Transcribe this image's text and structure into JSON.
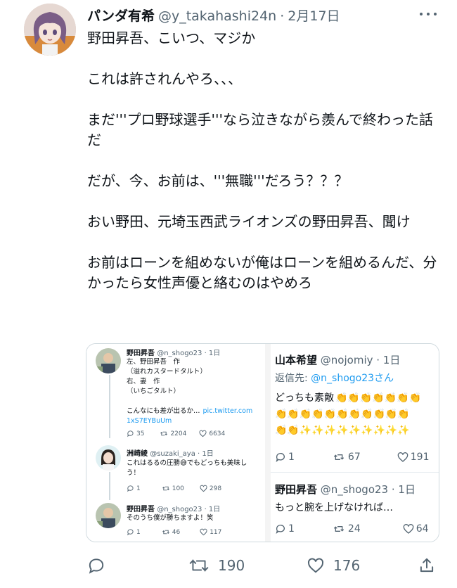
{
  "tweet": {
    "display_name": "パンダ有希",
    "handle": "@y_takahashi24n",
    "separator": "·",
    "date": "2月17日",
    "text_paragraphs": [
      "野田昇吾、こいつ、マジか",
      "これは許されんやろ、、、",
      "まだ'''プロ野球選手'''なら泣きながら羨んで終わった話だ",
      "だが、今、お前は、'''無職'''だろう？？？",
      "おい野田、元埼玉西武ライオンズの野田昇吾、聞け",
      "お前はローンを組めないが俺はローンを組めるんだ、分かったら女性声優と絡むのはやめろ"
    ],
    "stats": {
      "reply": "",
      "retweet": "190",
      "like": "176",
      "share": ""
    }
  },
  "embed": {
    "left": {
      "post1": {
        "name": "野田昇吾",
        "handle": "@n_shogo23",
        "time": "· 1日",
        "lines": [
          "左、野田昇吾　作",
          "（溢れカスタードタルト）",
          "右、妻　作",
          "（いちごタルト）",
          "",
          "こんなにも差が出るか…"
        ],
        "link1": "pic.twitter.com",
        "link2": "1xS7EYBuUm",
        "reply": "35",
        "retweet": "2204",
        "like": "6634"
      },
      "post2": {
        "name": "洲崎綾",
        "handle": "@suzaki_aya",
        "time": "· 1日",
        "line1": "これはるるの圧勝😅でもどっちも美味し",
        "line2": "う！",
        "reply": "1",
        "retweet": "100",
        "like": "298"
      },
      "post3": {
        "name": "野田昇吾",
        "handle": "@n_shogo23",
        "time": "· 1日",
        "line1": "そのうち僕が勝ちますよ！笑",
        "reply": "1",
        "retweet": "46",
        "like": "117"
      }
    },
    "right": {
      "post1": {
        "name": "山本希望",
        "handle": "@nojomiy",
        "time": "· 1日",
        "reply_to_label": "返信先: ",
        "reply_to_handle": "@n_shogo23さん",
        "text": "どっちも素敵",
        "clap_row1": "👏👏👏👏👏👏👏",
        "clap_row2": "👏👏👏👏👏👏👏👏👏👏👏",
        "clap_row3": "👏👏✨✨✨✨✨✨✨✨✨",
        "reply": "1",
        "retweet": "67",
        "like": "191"
      },
      "post2": {
        "name": "野田昇吾",
        "handle": "@n_shogo23",
        "time": "· 1日",
        "text": "もっと腕を上げなければ…",
        "reply": "1",
        "retweet": "24",
        "like": "64"
      }
    }
  },
  "colors": {
    "text": "#0f1419",
    "secondary": "#536471",
    "link": "#1d9bf0",
    "border": "#cfd9de",
    "background": "#ffffff"
  },
  "icons": [
    "more-icon",
    "reply-icon",
    "retweet-icon",
    "like-icon",
    "share-icon"
  ]
}
